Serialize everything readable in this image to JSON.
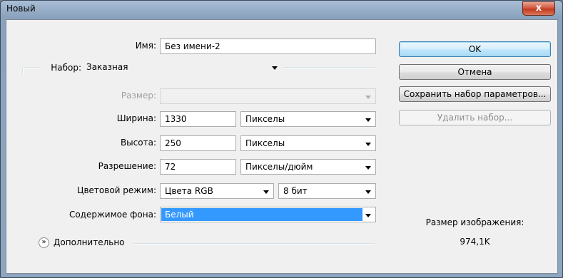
{
  "window": {
    "title": "Новый",
    "close_glyph": "x"
  },
  "form": {
    "name": {
      "label": "Имя:",
      "value": "Без имени-2"
    },
    "preset": {
      "label": "Набор:",
      "value": "Заказная"
    },
    "size": {
      "label": "Размер:",
      "value": ""
    },
    "width": {
      "label": "Ширина:",
      "value": "1330",
      "unit": "Пикселы"
    },
    "height": {
      "label": "Высота:",
      "value": "250",
      "unit": "Пикселы"
    },
    "resolution": {
      "label": "Разрешение:",
      "value": "72",
      "unit": "Пикселы/дюйм"
    },
    "color_mode": {
      "label": "Цветовой режим:",
      "value": "Цвета RGB",
      "depth": "8 бит"
    },
    "background": {
      "label": "Содержимое фона:",
      "value": "Белый"
    },
    "advanced": {
      "label": "Дополнительно",
      "icon": "double-chevron-down-icon"
    }
  },
  "buttons": {
    "ok": "OK",
    "cancel": "Отмена",
    "save_preset": "Сохранить набор параметров...",
    "delete_preset": "Удалить набор..."
  },
  "image_size": {
    "label": "Размер изображения:",
    "value": "974,1K"
  }
}
